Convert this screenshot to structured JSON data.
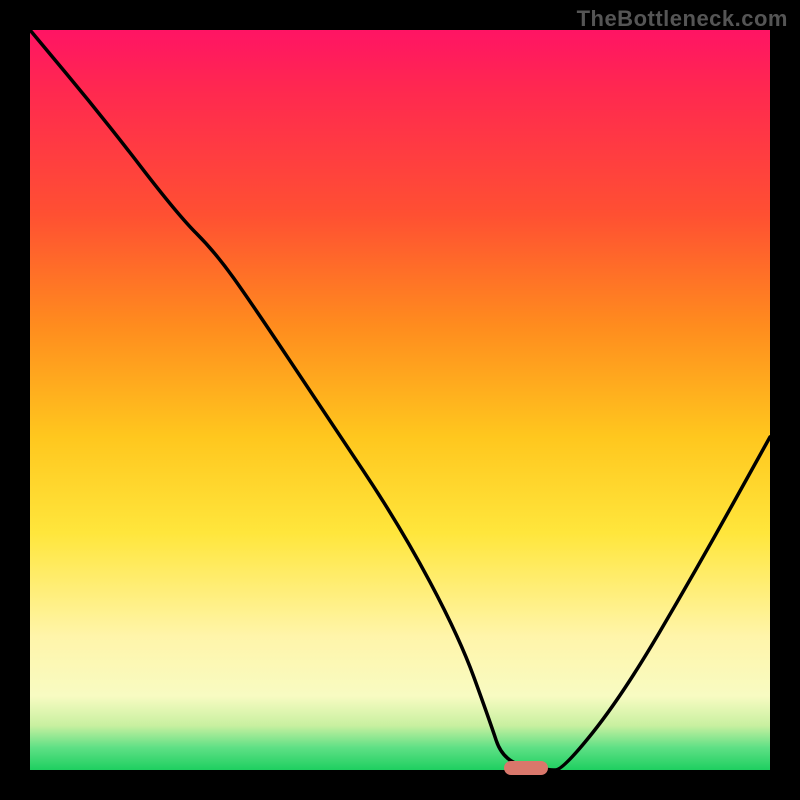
{
  "watermark": "TheBottleneck.com",
  "chart_data": {
    "type": "line",
    "title": "",
    "xlabel": "",
    "ylabel": "",
    "xlim": [
      0,
      100
    ],
    "ylim": [
      0,
      100
    ],
    "grid": false,
    "series": [
      {
        "name": "bottleneck-curve",
        "x": [
          0,
          10,
          20,
          25,
          30,
          40,
          50,
          58,
          62,
          64,
          70,
          72,
          80,
          90,
          100
        ],
        "y": [
          100,
          88,
          75,
          70,
          63,
          48,
          33,
          18,
          7,
          1,
          0,
          0,
          10,
          27,
          45
        ]
      }
    ],
    "background_gradient": {
      "orientation": "vertical",
      "stops": [
        {
          "pos": 0,
          "color": "#ff1464"
        },
        {
          "pos": 8,
          "color": "#ff2850"
        },
        {
          "pos": 25,
          "color": "#ff5032"
        },
        {
          "pos": 40,
          "color": "#ff8c1e"
        },
        {
          "pos": 55,
          "color": "#ffc71e"
        },
        {
          "pos": 68,
          "color": "#ffe63c"
        },
        {
          "pos": 82,
          "color": "#fff5aa"
        },
        {
          "pos": 90,
          "color": "#f8fbc2"
        },
        {
          "pos": 94,
          "color": "#c8f0a0"
        },
        {
          "pos": 97,
          "color": "#5ee085"
        },
        {
          "pos": 100,
          "color": "#1ecf60"
        }
      ]
    },
    "marker": {
      "x": 67,
      "y": 0,
      "color": "#d9776b",
      "shape": "pill"
    }
  }
}
